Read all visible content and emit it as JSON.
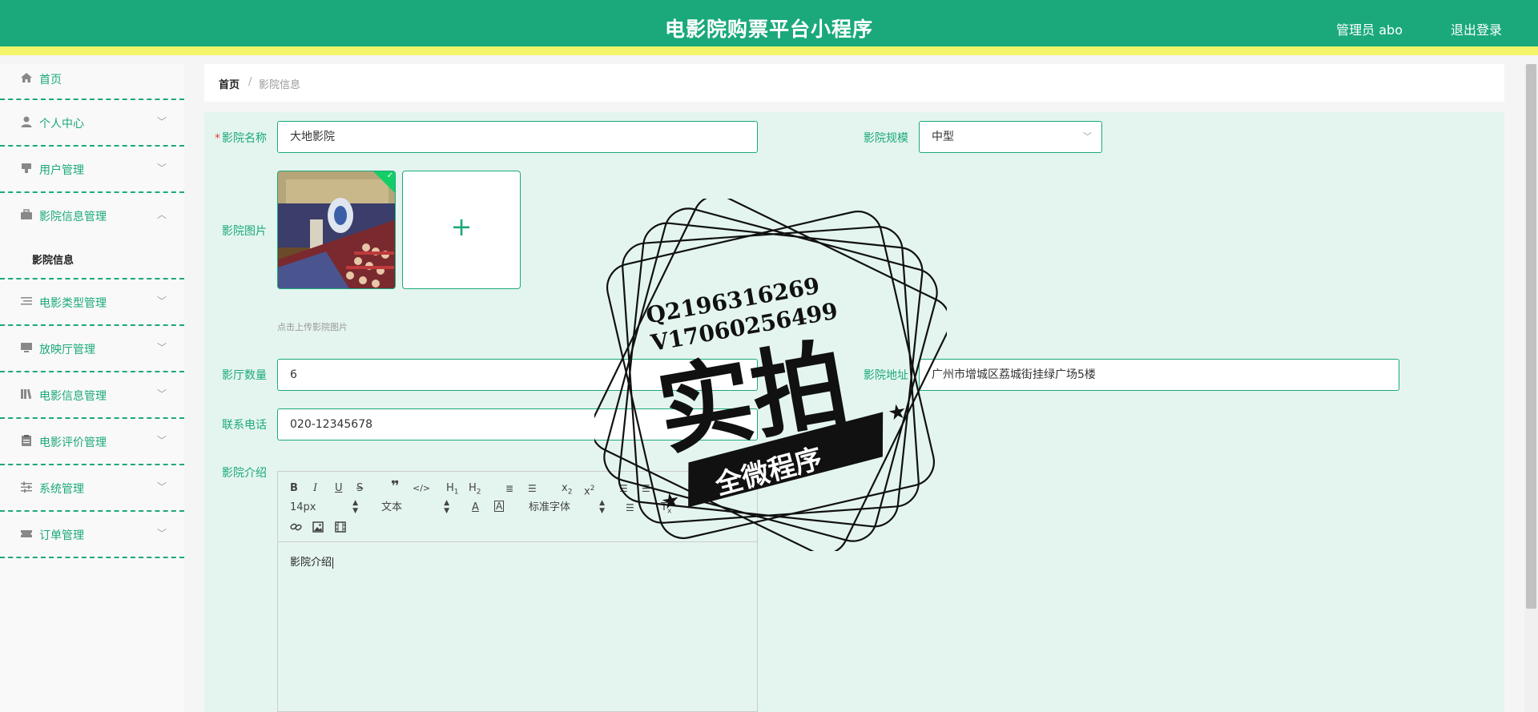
{
  "header": {
    "title": "电影院购票平台小程序",
    "user_label": "管理员 abo",
    "logout_label": "退出登录"
  },
  "sidebar": {
    "items": [
      {
        "label": "首页",
        "icon": "home-icon"
      },
      {
        "label": "个人中心",
        "icon": "user-icon"
      },
      {
        "label": "用户管理",
        "icon": "users-icon"
      },
      {
        "label": "影院信息管理",
        "icon": "briefcase-icon",
        "children": [
          {
            "label": "影院信息"
          }
        ]
      },
      {
        "label": "电影类型管理",
        "icon": "list-icon"
      },
      {
        "label": "放映厅管理",
        "icon": "monitor-icon"
      },
      {
        "label": "电影信息管理",
        "icon": "library-icon"
      },
      {
        "label": "电影评价管理",
        "icon": "clipboard-icon"
      },
      {
        "label": "系统管理",
        "icon": "sliders-icon"
      },
      {
        "label": "订单管理",
        "icon": "ticket-icon"
      }
    ]
  },
  "breadcrumb": {
    "home": "首页",
    "separator": "/",
    "current": "影院信息"
  },
  "form": {
    "name": {
      "label": "影院名称",
      "value": "大地影院",
      "required": true
    },
    "scale": {
      "label": "影院规模",
      "value": "中型"
    },
    "image": {
      "label": "影院图片",
      "hint": "点击上传影院图片",
      "upload_symbol": "+"
    },
    "hall_count": {
      "label": "影厅数量",
      "value": "6"
    },
    "address": {
      "label": "影院地址",
      "value": "广州市增城区荔城街挂绿广场5楼"
    },
    "phone": {
      "label": "联系电话",
      "value": "020-12345678"
    },
    "intro": {
      "label": "影院介绍",
      "value": "影院介绍"
    }
  },
  "editor": {
    "font_size": "14px",
    "block_type": "文本",
    "font_family": "标准字体"
  },
  "watermark": {
    "qq": "Q2196316269",
    "wechat": "V17060256499",
    "main": "实拍",
    "banner": "全微程序"
  },
  "colors": {
    "primary": "#1ba97b",
    "accent_bar": "#f4f46a",
    "form_bg": "#e4f5ef",
    "required": "#e64242"
  }
}
